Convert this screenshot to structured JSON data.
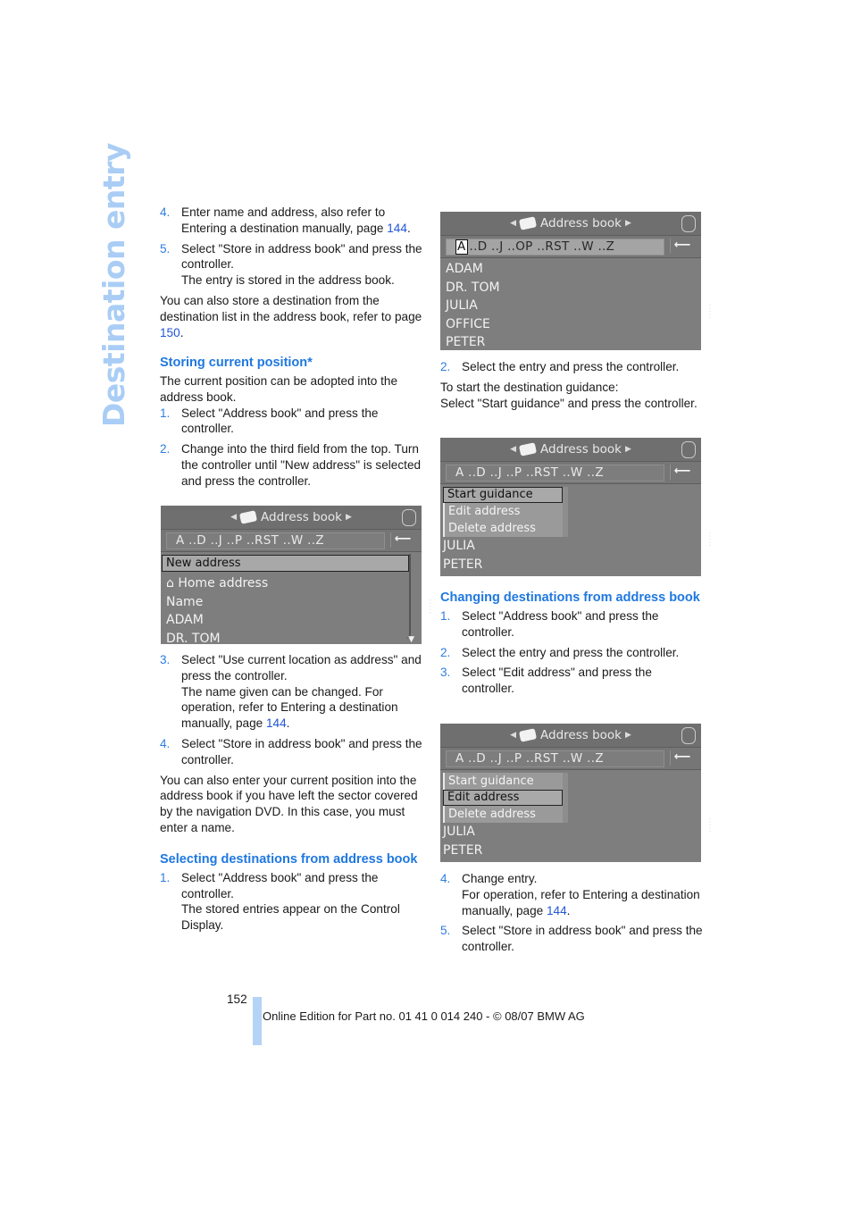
{
  "side_title": "Destination entry",
  "left": {
    "steps_top": [
      {
        "num": "4.",
        "text": "Enter name and address, also refer to Entering a destination manually, page ",
        "link": "144",
        "after": "."
      },
      {
        "num": "5.",
        "text": "Select \"Store in address book\" and press the controller.",
        "extra": "The entry is stored in the address book."
      }
    ],
    "para1": {
      "text": "You can also store a destination from the destination list in the address book, refer to page ",
      "link": "150",
      "after": "."
    },
    "heading_storing": "Storing current position*",
    "storing_intro": "The current position can be adopted into the address book.",
    "storing_steps": [
      {
        "num": "1.",
        "text": "Select \"Address book\" and press the controller."
      },
      {
        "num": "2.",
        "text": "Change into the third field from the top. Turn the controller until \"New address\" is selected and press the controller."
      }
    ],
    "steps_after": [
      {
        "num": "3.",
        "text": "Select \"Use current location as address\" and press the controller.",
        "extra": "The name given can be changed. For operation, refer to Entering a destination manually, page ",
        "link": "144",
        "after": "."
      },
      {
        "num": "4.",
        "text": "Select \"Store in address book\" and press the controller."
      }
    ],
    "para2": "You can also enter your current position into the address book if you have left the sector covered by the navigation DVD. In this case, you must enter a name.",
    "heading_selecting": "Selecting destinations from address book",
    "selecting_steps": [
      {
        "num": "1.",
        "text": "Select \"Address book\" and press the controller.",
        "extra": "The stored entries appear on the Control Display."
      }
    ]
  },
  "right": {
    "step2": {
      "num": "2.",
      "text": "Select the entry and press the controller."
    },
    "guidance_lines": [
      "To start the destination guidance:",
      "Select \"Start guidance\" and press the controller."
    ],
    "heading_changing": "Changing destinations from address book",
    "changing_steps": [
      {
        "num": "1.",
        "text": "Select \"Address book\" and press the controller."
      },
      {
        "num": "2.",
        "text": "Select the entry and press the controller."
      },
      {
        "num": "3.",
        "text": "Select \"Edit address\" and press the controller."
      }
    ],
    "final_steps": [
      {
        "num": "4.",
        "text": "Change entry.",
        "extra": "For operation, refer to Entering a destination manually, page ",
        "link": "144",
        "after": "."
      },
      {
        "num": "5.",
        "text": "Select \"Store in address book\" and press the controller."
      }
    ]
  },
  "screens": {
    "title": "Address book",
    "back_icon": "⟵",
    "s1": {
      "selected_letter": "A",
      "letters": " ..D ..J ..OP ..RST ..W ..Z",
      "rows": [
        "ADAM",
        "DR. TOM",
        "JULIA",
        "OFFICE",
        "PETER"
      ]
    },
    "s2": {
      "letters": "A ..D ..J ..P ..RST ..W ..Z",
      "selected_row": "New address",
      "rows": [
        "⌂ Home address",
        "Name",
        "ADAM",
        "DR. TOM"
      ]
    },
    "s3": {
      "letters": "A ..D ..J ..P ..RST ..W ..Z",
      "menu": [
        "Start guidance",
        "Edit address",
        "Delete address"
      ],
      "menu_selected": 0,
      "rows": [
        "JULIA",
        "PETER"
      ]
    },
    "s4": {
      "letters": "A ..D ..J ..P ..RST ..W ..Z",
      "menu": [
        "Start guidance",
        "Edit address",
        "Delete address"
      ],
      "menu_selected": 1,
      "rows": [
        "JULIA",
        "PETER"
      ]
    }
  },
  "footer": {
    "page_number": "152",
    "text": "Online Edition for Part no. 01 41 0 014 240 - © 08/07 BMW AG"
  },
  "colors": {
    "accent": "#1f78e0",
    "link": "#2155d6",
    "side_title": "#a9cdf5",
    "footer_bar": "#b4d3f7"
  }
}
